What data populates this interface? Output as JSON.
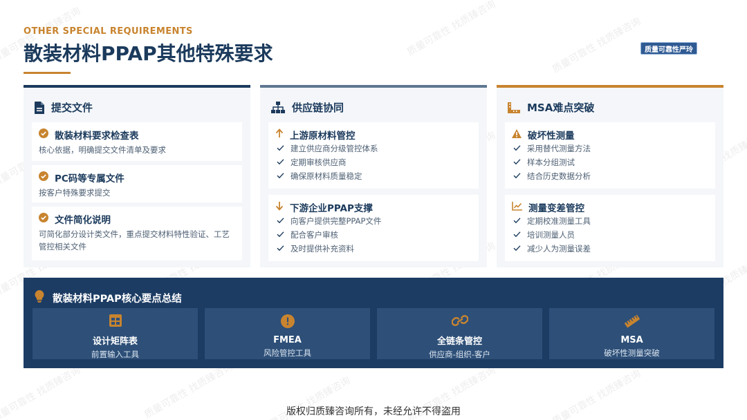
{
  "header": {
    "eyebrow": "OTHER SPECIAL REQUIREMENTS",
    "title": "散装材料PPAP其他特殊要求",
    "badge": "质量可靠性严玲"
  },
  "watermark_text": "质量可靠性 找质臻咨询",
  "colors": {
    "navy": "#1b3a5c",
    "accent": "#c8842f",
    "slate": "#5e7791",
    "summary_bg": "#1c3c64",
    "tile_bg": "#2d4f78"
  },
  "cards": [
    {
      "title": "提交文件",
      "icon": "document-icon",
      "sections": [
        {
          "title": "散装材料要求检查表",
          "icon": "check-circle-icon",
          "desc": "核心依据，明确提交文件清单及要求"
        },
        {
          "title": "PC码等专属文件",
          "icon": "check-circle-icon",
          "desc": "按客户特殊要求提交"
        },
        {
          "title": "文件简化说明",
          "icon": "check-circle-icon",
          "desc": "可简化部分设计类文件，重点提交材料特性验证、工艺管控相关文件"
        }
      ]
    },
    {
      "title": "供应链协同",
      "icon": "network-icon",
      "sections": [
        {
          "title": "上游原材料管控",
          "icon": "arrow-up-icon",
          "items": [
            "建立供应商分级管控体系",
            "定期审核供应商",
            "确保原材料质量稳定"
          ]
        },
        {
          "title": "下游企业PPAP支撑",
          "icon": "arrow-down-icon",
          "items": [
            "向客户提供完整PPAP文件",
            "配合客户审核",
            "及时提供补充资料"
          ]
        }
      ]
    },
    {
      "title": "MSA难点突破",
      "icon": "ruler-combined-icon",
      "sections": [
        {
          "title": "破坏性测量",
          "icon": "warning-icon",
          "items": [
            "采用替代测量方法",
            "样本分组测试",
            "结合历史数据分析"
          ]
        },
        {
          "title": "测量变差管控",
          "icon": "line-chart-icon",
          "items": [
            "定期校准测量工具",
            "培训测量人员",
            "减少人为测量误差"
          ]
        }
      ]
    }
  ],
  "summary": {
    "title": "散装材料PPAP核心要点总结",
    "icon": "lightbulb-icon",
    "tiles": [
      {
        "title": "设计矩阵表",
        "desc": "前置输入工具",
        "icon": "table-icon"
      },
      {
        "title": "FMEA",
        "desc": "风险管控工具",
        "icon": "exclamation-circle-icon"
      },
      {
        "title": "全链条管控",
        "desc": "供应商-组织-客户",
        "icon": "link-icon"
      },
      {
        "title": "MSA",
        "desc": "破坏性测量突破",
        "icon": "ruler-icon"
      }
    ]
  },
  "footer": "版权归质臻咨询所有，未经允许不得盗用"
}
